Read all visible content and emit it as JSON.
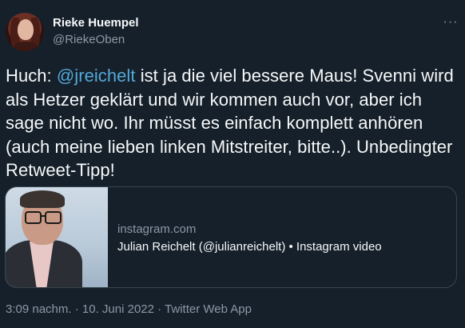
{
  "tweet": {
    "author_name": "Rieke Huempel",
    "author_handle": "@RiekeOben",
    "more_label": "···",
    "text_prefix": "Huch: ",
    "mention": "@jreichelt",
    "text_body": " ist ja die viel bessere Maus! Svenni wird als Hetzer geklärt und wir kommen auch vor, aber ich sage nicht wo. Ihr müsst es einfach komplett anhören (auch meine lieben linken Mitstreiter, bitte..). Unbedingter Retweet-Tipp!",
    "card": {
      "domain": "instagram.com",
      "title": "Julian Reichelt (@julianreichelt) • Instagram video"
    },
    "time": "3:09 nachm.",
    "separator": " · ",
    "date": "10. Juni 2022",
    "source": "Twitter Web App"
  },
  "colors": {
    "background": "#15202b",
    "text": "#f7f9f9",
    "secondary_text": "#8b98a5",
    "mention": "#54a8d8",
    "border": "#38444d"
  }
}
